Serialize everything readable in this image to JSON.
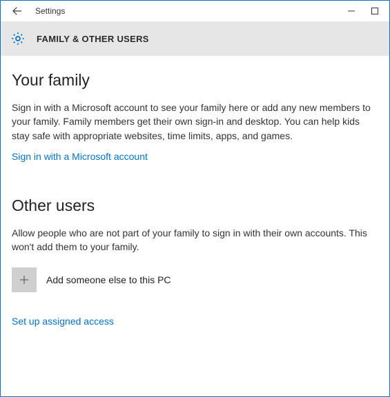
{
  "titlebar": {
    "title": "Settings"
  },
  "subheader": {
    "label": "FAMILY & OTHER USERS"
  },
  "family": {
    "heading": "Your family",
    "description": "Sign in with a Microsoft account to see your family here or add any new members to your family. Family members get their own sign-in and desktop. You can help kids stay safe with appropriate websites, time limits, apps, and games.",
    "signin_link": "Sign in with a Microsoft account"
  },
  "other": {
    "heading": "Other users",
    "description": "Allow people who are not part of your family to sign in with their own accounts. This won't add them to your family.",
    "add_label": "Add someone else to this PC",
    "assigned_link": "Set up assigned access"
  }
}
